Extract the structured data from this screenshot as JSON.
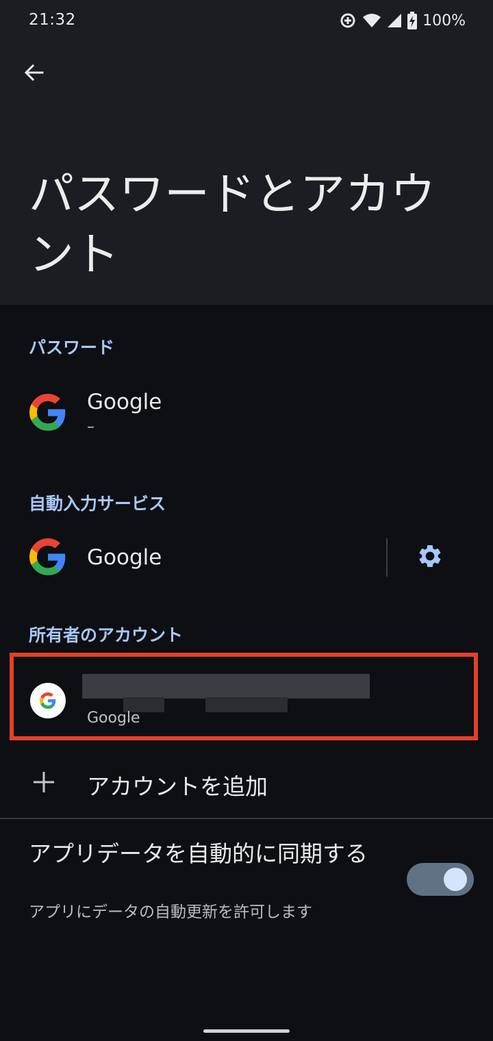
{
  "status_bar": {
    "time": "21:32",
    "battery": "100%",
    "icons": [
      "data-saver-icon",
      "wifi-icon",
      "signal-icon",
      "battery-charging-icon"
    ]
  },
  "toolbar": {
    "back_icon": "arrow-back-icon"
  },
  "title": "パスワードとアカウント",
  "passwords": {
    "header": "パスワード",
    "item": {
      "title": "Google",
      "subtitle": "–"
    }
  },
  "autofill": {
    "header": "自動入力サービス",
    "item": {
      "title": "Google"
    },
    "settings_icon": "gear-icon"
  },
  "owner_accounts": {
    "header": "所有者のアカウント",
    "item": {
      "subtitle": "Google"
    }
  },
  "add_account": {
    "label": "アカウントを追加",
    "icon": "plus-icon"
  },
  "sync": {
    "title": "アプリデータを自動的に同期する",
    "subtitle": "アプリにデータの自動更新を許可します",
    "enabled": true
  },
  "colors": {
    "accent": "#a8c7fa",
    "highlight_border": "#e3402a",
    "toggle_track": "#5f7285",
    "toggle_knob": "#d3e5fb"
  }
}
